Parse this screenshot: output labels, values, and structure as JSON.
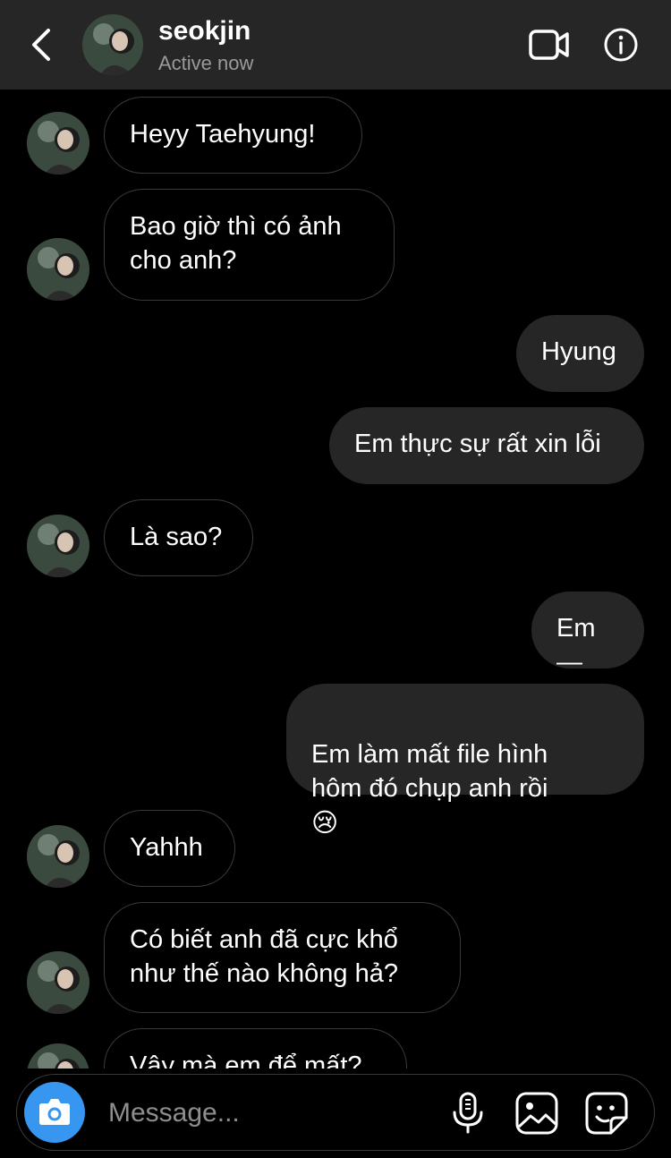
{
  "header": {
    "name": "seokjin",
    "status": "Active now",
    "back_icon": "chevron-left-icon",
    "video_icon": "video-camera-icon",
    "info_icon": "info-icon"
  },
  "messages": [
    {
      "direction": "in",
      "text": "Heyy Taehyung!"
    },
    {
      "direction": "in",
      "text": "Bao giờ thì có ảnh\ncho anh?"
    },
    {
      "direction": "out",
      "text": "Hyung"
    },
    {
      "direction": "out",
      "text": "Em thực sự rất xin lỗi"
    },
    {
      "direction": "in",
      "text": "Là sao?"
    },
    {
      "direction": "out",
      "text": "Em—"
    },
    {
      "direction": "out",
      "text": "Em làm mất file hình\nhôm đó chụp anh rồi",
      "emoji": "😢"
    },
    {
      "direction": "in",
      "text": "Yahhh"
    },
    {
      "direction": "in",
      "text": "Có biết anh đã cực khổ\nnhư thế nào không hả?"
    },
    {
      "direction": "in",
      "text": "Vậy mà em để mất?"
    }
  ],
  "composer": {
    "placeholder": "Message...",
    "camera_icon": "camera-icon",
    "mic_icon": "microphone-icon",
    "gallery_icon": "gallery-icon",
    "sticker_icon": "sticker-icon"
  },
  "colors": {
    "background": "#000000",
    "header": "#262626",
    "outgoing_bubble": "#262626",
    "incoming_border": "#3a3a3a",
    "accent": "#3797f0",
    "muted_text": "#9a9a9a"
  }
}
